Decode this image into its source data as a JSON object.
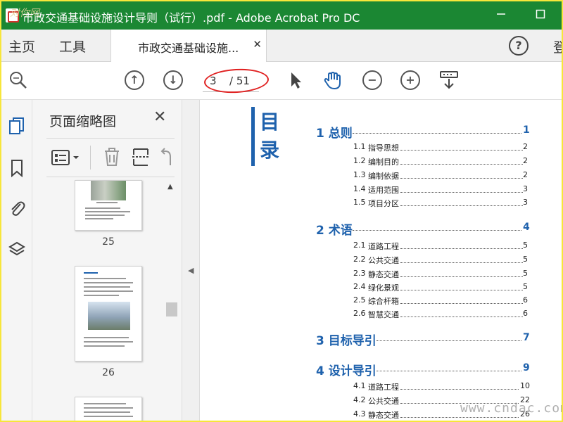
{
  "window": {
    "title": "市政交通基础设施设计导则（试行）.pdf - Adobe Acrobat Pro DC",
    "watermark_top": "对你网"
  },
  "tabs": {
    "home": "主页",
    "tools": "工具",
    "document": "市政交通基础设施...",
    "cut_text": "登"
  },
  "toolbar": {
    "current_page": "3",
    "total_pages": "/ 51"
  },
  "panel": {
    "title": "页面缩略图",
    "thumbnails": [
      {
        "label": "25"
      },
      {
        "label": "26"
      }
    ]
  },
  "document": {
    "heading": [
      "目",
      "录"
    ],
    "toc": [
      {
        "level": 1,
        "title": "1 总则",
        "page": "1"
      },
      {
        "level": 2,
        "num": "1.1",
        "title": "指导思想",
        "page": "2"
      },
      {
        "level": 2,
        "num": "1.2",
        "title": "编制目的",
        "page": "2"
      },
      {
        "level": 2,
        "num": "1.3",
        "title": "编制依据",
        "page": "2"
      },
      {
        "level": 2,
        "num": "1.4",
        "title": "适用范围",
        "page": "3"
      },
      {
        "level": 2,
        "num": "1.5",
        "title": "项目分区",
        "page": "3"
      },
      {
        "level": 1,
        "title": "2 术语",
        "page": "4"
      },
      {
        "level": 2,
        "num": "2.1",
        "title": "道路工程",
        "page": "5"
      },
      {
        "level": 2,
        "num": "2.2",
        "title": "公共交通",
        "page": "5"
      },
      {
        "level": 2,
        "num": "2.3",
        "title": "静态交通",
        "page": "5"
      },
      {
        "level": 2,
        "num": "2.4",
        "title": "绿化景观",
        "page": "5"
      },
      {
        "level": 2,
        "num": "2.5",
        "title": "综合杆箱",
        "page": "6"
      },
      {
        "level": 2,
        "num": "2.6",
        "title": "智慧交通",
        "page": "6"
      },
      {
        "level": 1,
        "title": "3 目标导引",
        "page": "7"
      },
      {
        "level": 1,
        "title": "4 设计导引",
        "page": "9"
      },
      {
        "level": 2,
        "num": "4.1",
        "title": "道路工程",
        "page": "10"
      },
      {
        "level": 2,
        "num": "4.2",
        "title": "公共交通",
        "page": "22"
      },
      {
        "level": 2,
        "num": "4.3",
        "title": "静态交通",
        "page": "26"
      }
    ]
  },
  "watermark_bottom": "www.cndac.com",
  "colors": {
    "titlebar": "#1b8733",
    "accent_blue": "#1f62ad",
    "highlight_red": "#e02020"
  }
}
